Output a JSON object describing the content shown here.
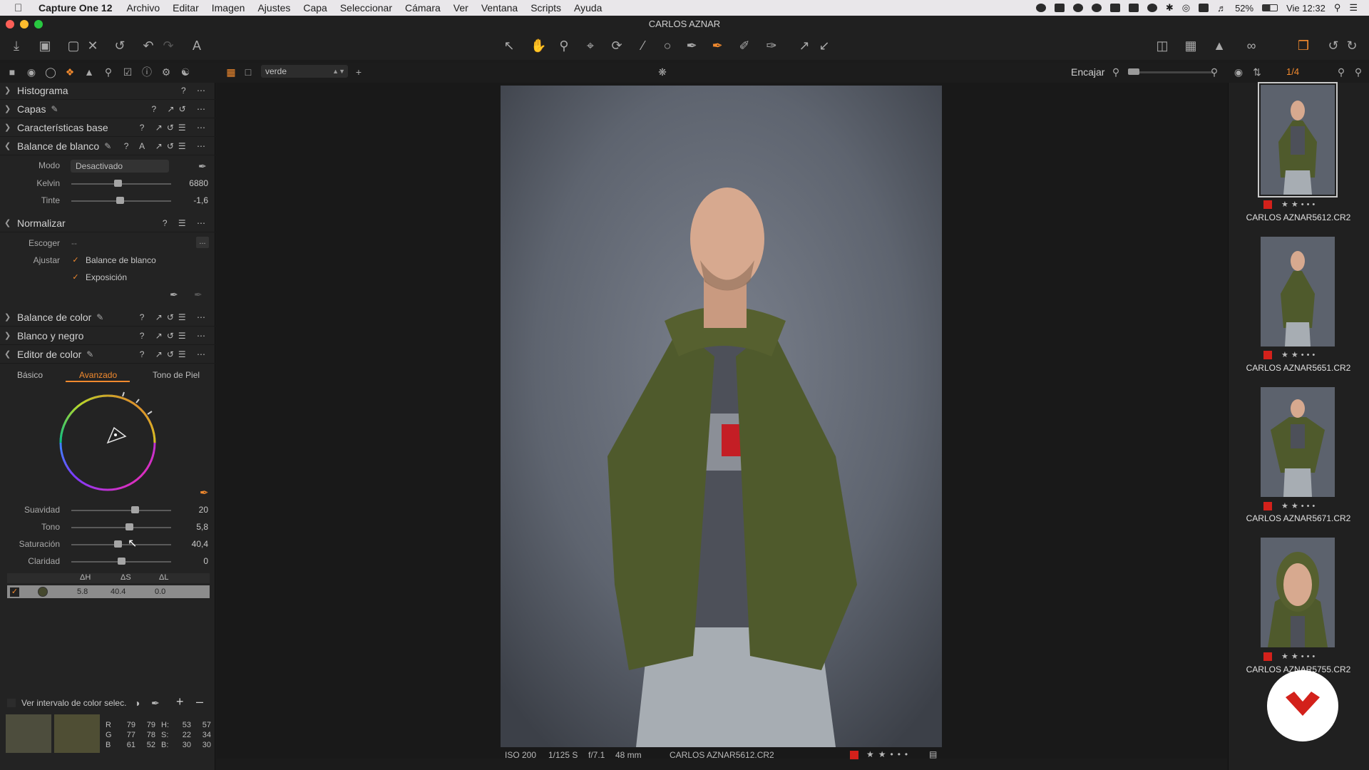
{
  "menubar": {
    "app_name": "Capture One 12",
    "items": [
      "Archivo",
      "Editar",
      "Imagen",
      "Ajustes",
      "Capa",
      "Seleccionar",
      "Cámara",
      "Ver",
      "Ventana",
      "Scripts",
      "Ayuda"
    ],
    "battery": "52%",
    "clock": "Vie 12:32"
  },
  "window": {
    "title": "CARLOS AZNAR"
  },
  "subbar": {
    "collection": "verde",
    "zoom_label": "Encajar",
    "counter": "1/4"
  },
  "left_panel": {
    "histogram": "Histograma",
    "layers": "Capas",
    "base_chars": "Características base",
    "white_balance": {
      "title": "Balance de blanco",
      "mode_label": "Modo",
      "mode_value": "Desactivado",
      "kelvin_label": "Kelvin",
      "kelvin_value": "6880",
      "kelvin_level": 0.47,
      "tint_label": "Tinte",
      "tint_value": "-1,6",
      "tint_level": 0.49
    },
    "normalize": {
      "title": "Normalizar",
      "pick_label": "Escoger",
      "pick_value": "--",
      "pick_button": "...",
      "adjust_label": "Ajustar",
      "opt1": "Balance de blanco",
      "opt2": "Exposición"
    },
    "color_balance": "Balance de color",
    "black_white": "Blanco y negro",
    "color_editor": {
      "title": "Editor de color",
      "tabs": [
        "Básico",
        "Avanzado",
        "Tono de Piel"
      ],
      "smooth_label": "Suavidad",
      "smooth_value": "20",
      "smooth_level": 0.64,
      "hue_label": "Tono",
      "hue_value": "5,8",
      "hue_level": 0.58,
      "sat_label": "Saturación",
      "sat_value": "40,4",
      "sat_level": 0.47,
      "clarity_label": "Claridad",
      "clarity_value": "0",
      "clarity_level": 0.5,
      "table_headers": [
        "ΔH",
        "ΔS",
        "ΔL"
      ],
      "table_row": [
        "5.8",
        "40.4",
        "0.0"
      ],
      "show_range": "Ver intervalo de color selec.",
      "rgb": {
        "r_label": "R",
        "g_label": "G",
        "b_label": "B",
        "r1": "79",
        "r2": "79",
        "g1": "77",
        "g2": "78",
        "b1": "61",
        "b2": "52",
        "h_label": "H:",
        "s_label": "S:",
        "b2_label": "B:",
        "h1": "53",
        "h2": "57",
        "s1": "22",
        "s2": "34",
        "bb1": "30",
        "bb2": "30"
      }
    }
  },
  "status": {
    "iso": "ISO 200",
    "shutter": "1/125 S",
    "aperture": "f/7.1",
    "focal": "48 mm",
    "file": "CARLOS AZNAR5612.CR2"
  },
  "thumbnails": [
    {
      "name": "CARLOS AZNAR5612.CR2"
    },
    {
      "name": "CARLOS AZNAR5651.CR2"
    },
    {
      "name": "CARLOS AZNAR5671.CR2"
    },
    {
      "name": "CARLOS AZNAR5755.CR2"
    }
  ],
  "colors": {
    "accent": "#f28a2e",
    "flag_red": "#d3211b",
    "jacket": "#4f5a2c"
  }
}
